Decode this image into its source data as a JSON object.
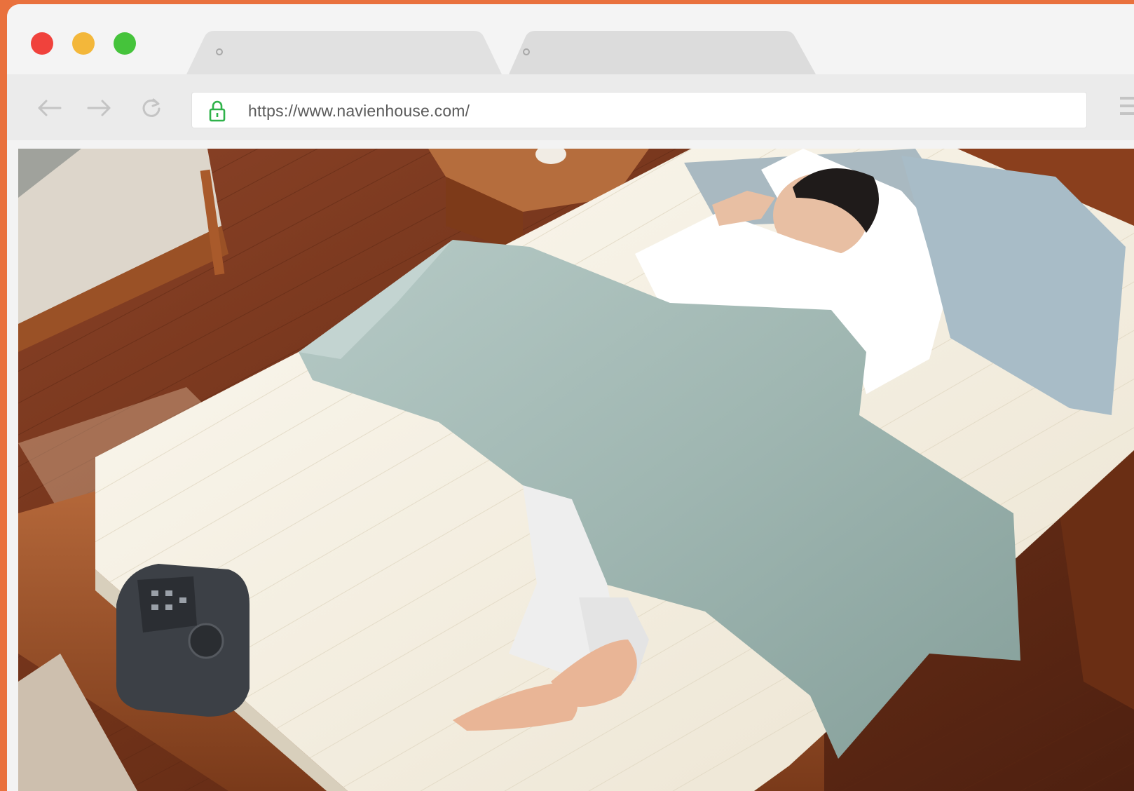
{
  "browser": {
    "tabs": [
      {
        "label": ""
      },
      {
        "label": ""
      }
    ],
    "address_bar": {
      "url": "https://www.navienhouse.com/",
      "secure": true
    },
    "nav_icons": [
      "back-arrow-icon",
      "forward-arrow-icon",
      "reload-icon"
    ],
    "traffic_lights": {
      "close": "#f0423c",
      "minimize": "#f3b73a",
      "maximize": "#45c33b"
    },
    "frame_accent": "#e9713d"
  },
  "page": {
    "hero_image": "man-sleeping-on-heated-mattress-pad-with-control-unit"
  }
}
